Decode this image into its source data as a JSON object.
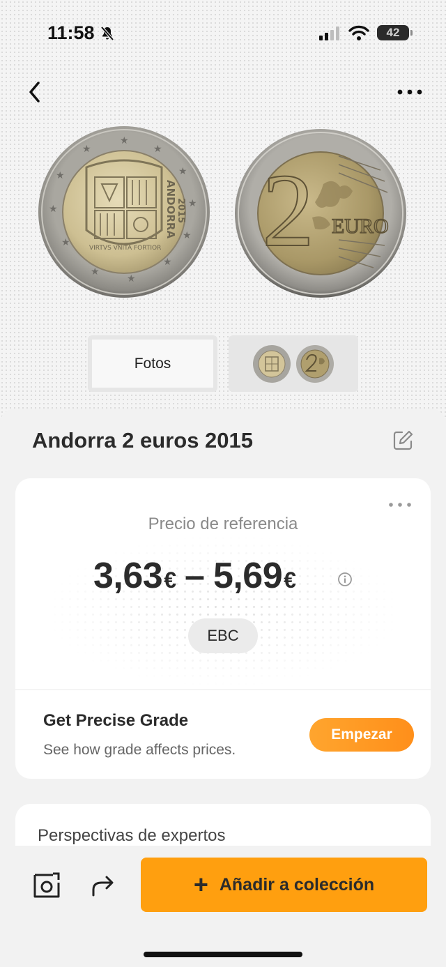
{
  "status_bar": {
    "time": "11:58",
    "battery": "42",
    "icons": [
      "bell-slash-icon",
      "signal-icon",
      "wifi-icon",
      "battery-icon"
    ]
  },
  "nav": {
    "back_icon": "chevron-left-icon",
    "more_icon": "more-horizontal-icon"
  },
  "gallery": {
    "coin_obverse_inscriptions": {
      "country": "ANDORRA",
      "year": "2015",
      "motto": "VIRTVS VNITA FORTIOR"
    },
    "coin_reverse_inscriptions": {
      "value": "2",
      "unit": "EURO"
    },
    "thumbnails": [
      {
        "label": "Fotos",
        "selected": true
      },
      {
        "label": "",
        "selected": false
      }
    ]
  },
  "coin": {
    "title": "Andorra 2 euros 2015",
    "edit_icon": "edit-icon"
  },
  "price_card": {
    "more_icon": "more-horizontal-icon",
    "reference_label": "Precio de referencia",
    "price_low": "3,63",
    "price_high": "5,69",
    "currency": "€",
    "dash": "–",
    "info_icon": "info-icon",
    "grade_chip": "EBC",
    "grade_title": "Get Precise Grade",
    "grade_subtitle": "See how grade affects prices.",
    "start_button": "Empezar"
  },
  "experts": {
    "title": "Perspectivas de expertos"
  },
  "bottom_bar": {
    "camera_icon": "camera-icon",
    "share_icon": "share-arrow-icon",
    "add_icon": "plus-icon",
    "add_label": "Añadir a colección"
  },
  "colors": {
    "accent": "#ff9f0f",
    "start_button": "#ff961f",
    "background": "#f2f2f2",
    "card": "#ffffff",
    "text": "#2b2b2b"
  }
}
